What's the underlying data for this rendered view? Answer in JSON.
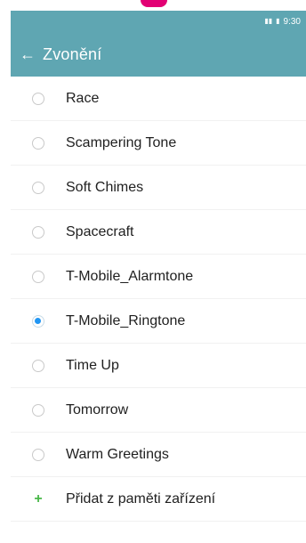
{
  "status_bar": {
    "time": "9:30",
    "signal_icon": "signal-icon",
    "battery_icon": "battery-icon"
  },
  "header": {
    "title": "Zvonění",
    "back_icon": "arrow-left-icon"
  },
  "ringtones": [
    {
      "label": "Race",
      "selected": false
    },
    {
      "label": "Scampering Tone",
      "selected": false
    },
    {
      "label": "Soft Chimes",
      "selected": false
    },
    {
      "label": "Spacecraft",
      "selected": false
    },
    {
      "label": "T-Mobile_Alarmtone",
      "selected": false
    },
    {
      "label": "T-Mobile_Ringtone",
      "selected": true
    },
    {
      "label": "Time Up",
      "selected": false
    },
    {
      "label": "Tomorrow",
      "selected": false
    },
    {
      "label": "Warm Greetings",
      "selected": false
    }
  ],
  "add_item": {
    "label": "Přidat z paměti zařízení",
    "icon": "plus-icon"
  },
  "colors": {
    "header_bg": "#5fa6b2",
    "accent_blue": "#2196f3",
    "add_green": "#48b848",
    "brand_magenta": "#e20074"
  }
}
